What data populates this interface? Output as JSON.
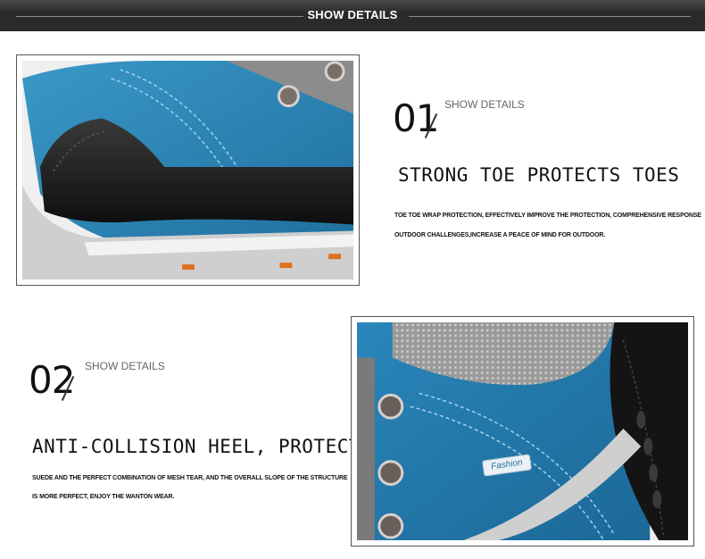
{
  "header": {
    "title": "SHOW DETAILS"
  },
  "section1": {
    "number": "01",
    "label": "SHOW DETAILS",
    "headline": "STRONG TOE PROTECTS TOES",
    "desc_line1": "TOE TOE WRAP PROTECTION, EFFECTIVELY IMPROVE THE PROTECTION, COMPREHENSIVE RESPONSE",
    "desc_line2": "OUTDOOR CHALLENGES,INCREASE A PEACE OF MIND FOR OUTDOOR."
  },
  "section2": {
    "number": "02",
    "label": "SHOW DETAILS",
    "headline": "ANTI-COLLISION HEEL, PROTECT HEEL",
    "desc_line1": "SUEDE AND THE PERFECT COMBINATION OF MESH TEAR, AND THE OVERALL SLOPE OF THE STRUCTURE",
    "desc_line2": "IS MORE PERFECT, ENJOY THE WANTON WEAR.",
    "badge_text": "Fashion"
  },
  "colors": {
    "suede_blue": "#2f86b8",
    "black_leather": "#1a1a1a",
    "sole_gray": "#c9c9c9",
    "accent_orange": "#e07020"
  }
}
